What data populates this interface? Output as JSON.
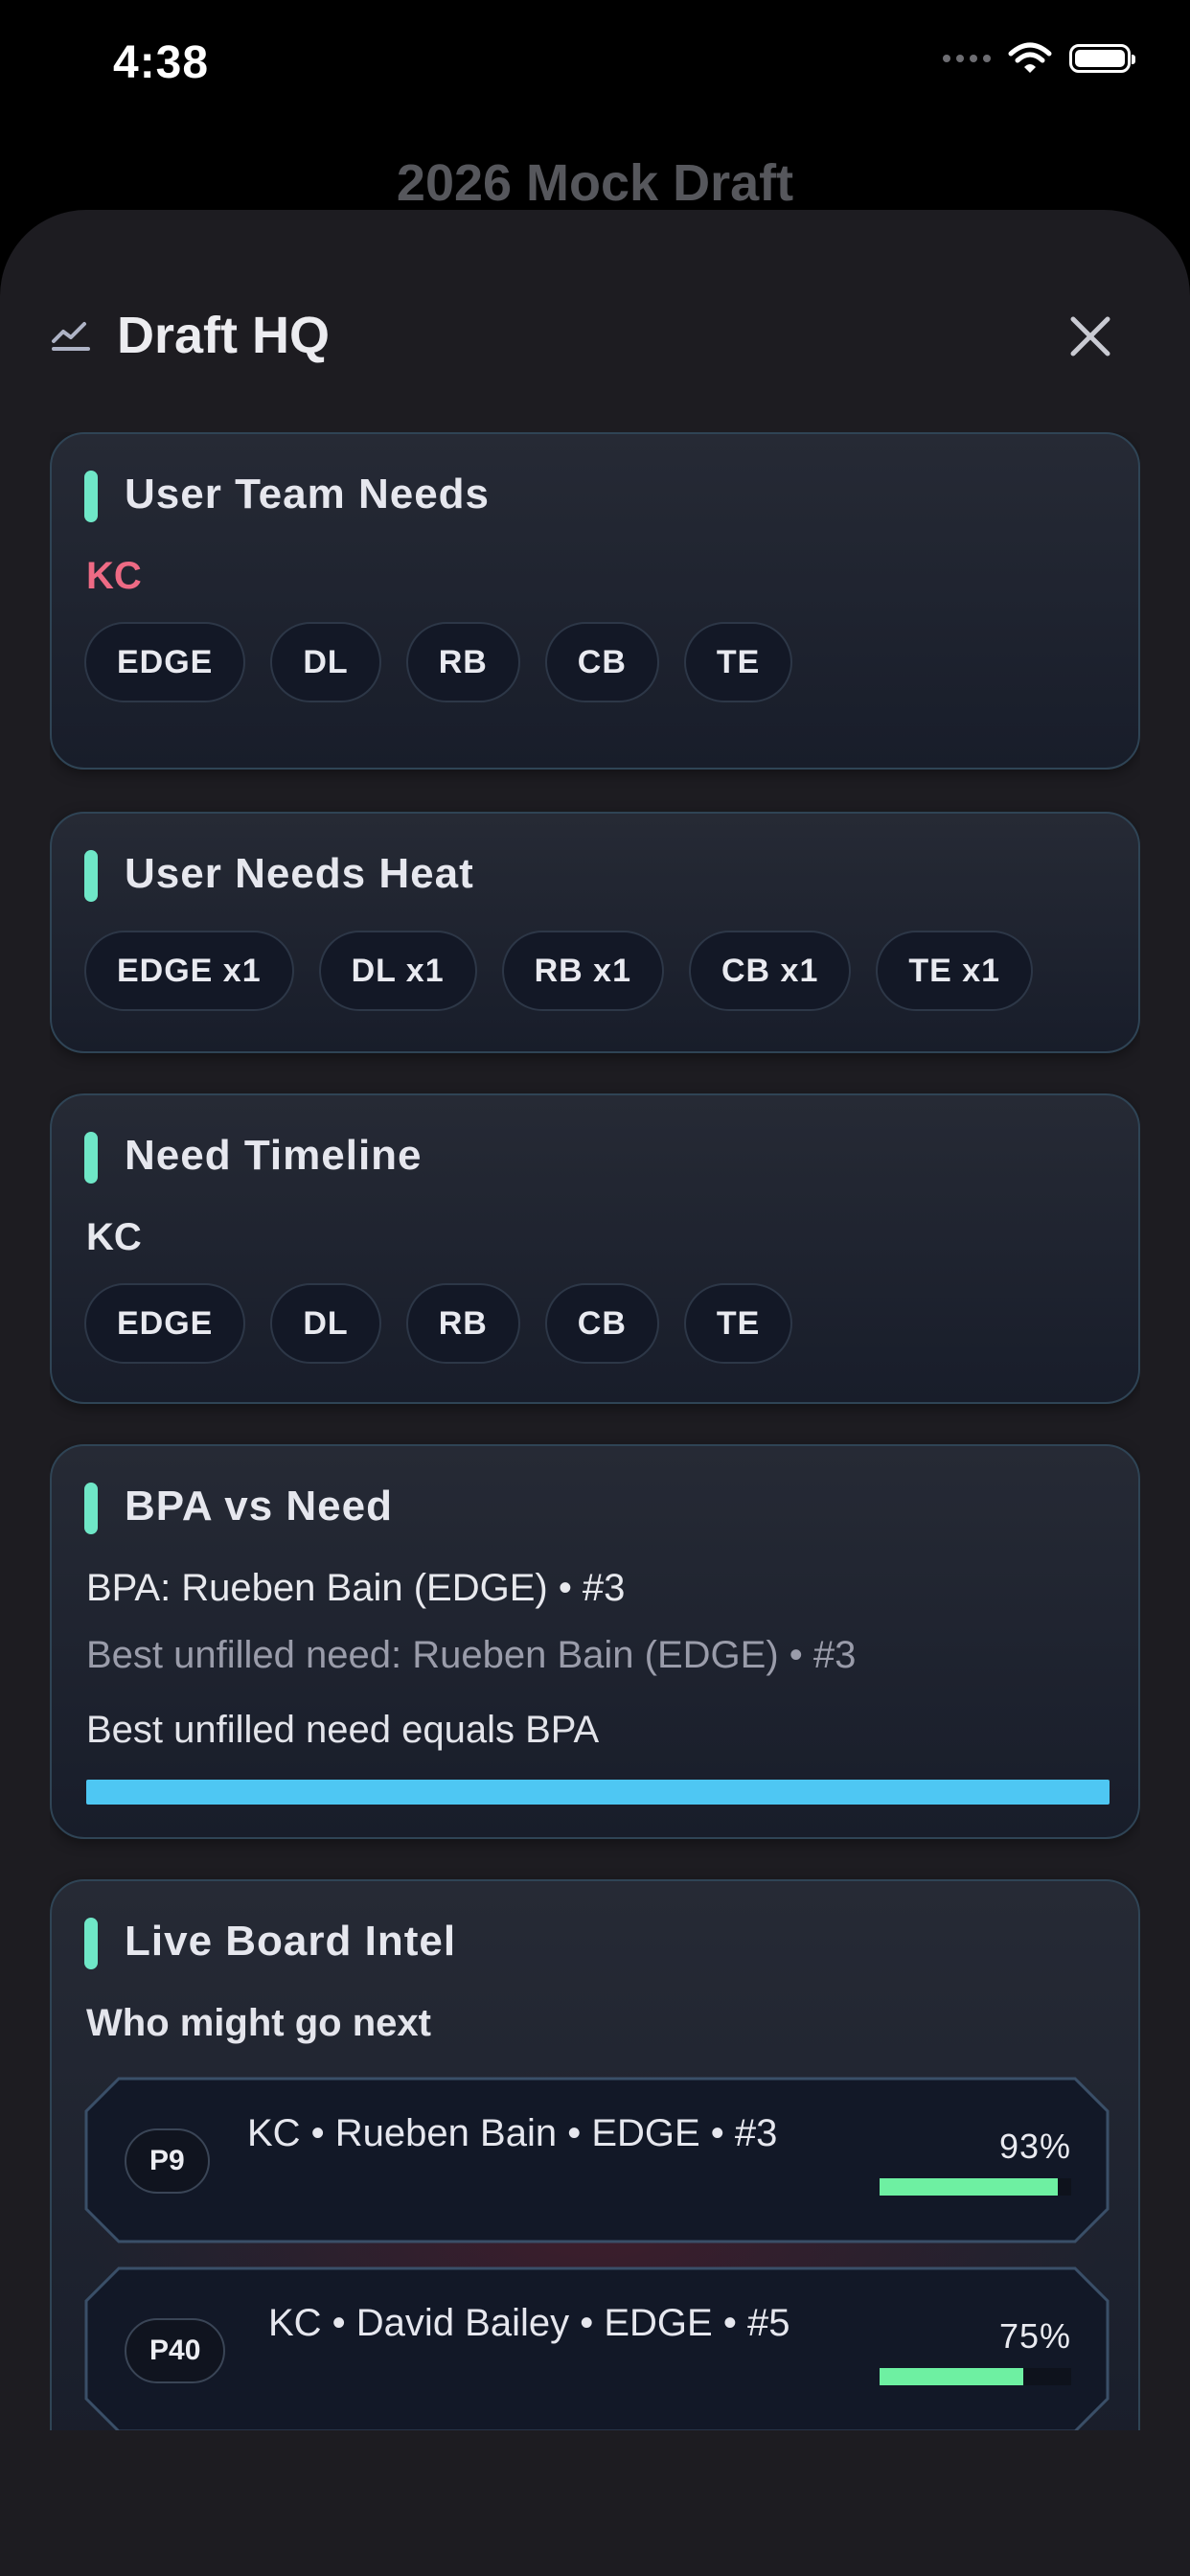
{
  "status_bar": {
    "time": "4:38"
  },
  "background_title": "2026 Mock Draft",
  "sheet": {
    "title": "Draft HQ"
  },
  "cards": {
    "user_team_needs": {
      "title": "User Team Needs",
      "team": "KC",
      "chips": [
        "EDGE",
        "DL",
        "RB",
        "CB",
        "TE"
      ]
    },
    "user_needs_heat": {
      "title": "User Needs Heat",
      "chips": [
        "EDGE x1",
        "DL x1",
        "RB x1",
        "CB x1",
        "TE x1"
      ]
    },
    "need_timeline": {
      "title": "Need Timeline",
      "team": "KC",
      "chips": [
        "EDGE",
        "DL",
        "RB",
        "CB",
        "TE"
      ]
    },
    "bpa_vs_need": {
      "title": "BPA vs Need",
      "bpa_line": "BPA: Rueben Bain (EDGE) • #3",
      "best_need_line": "Best unfilled need: Rueben Bain (EDGE) • #3",
      "equals_line": "Best unfilled need equals BPA",
      "match_fraction": 1.0
    },
    "live_board_intel": {
      "title": "Live Board Intel",
      "subtitle": "Who might go next",
      "predictions": [
        {
          "pick": "P9",
          "text": "KC • Rueben Bain • EDGE • #3",
          "percent_label": "93%",
          "percent": 93
        },
        {
          "pick": "P40",
          "text": "KC • David Bailey • EDGE • #5",
          "percent_label": "75%",
          "percent": 75
        }
      ]
    }
  },
  "colors": {
    "accent_teal": "#6fe7c7",
    "team_red": "#ee6a84",
    "progress_blue": "#4ec7f3",
    "probability_green": "#6ef0a2"
  },
  "icons": {
    "header": "chart-line-icon",
    "close": "close-icon"
  }
}
